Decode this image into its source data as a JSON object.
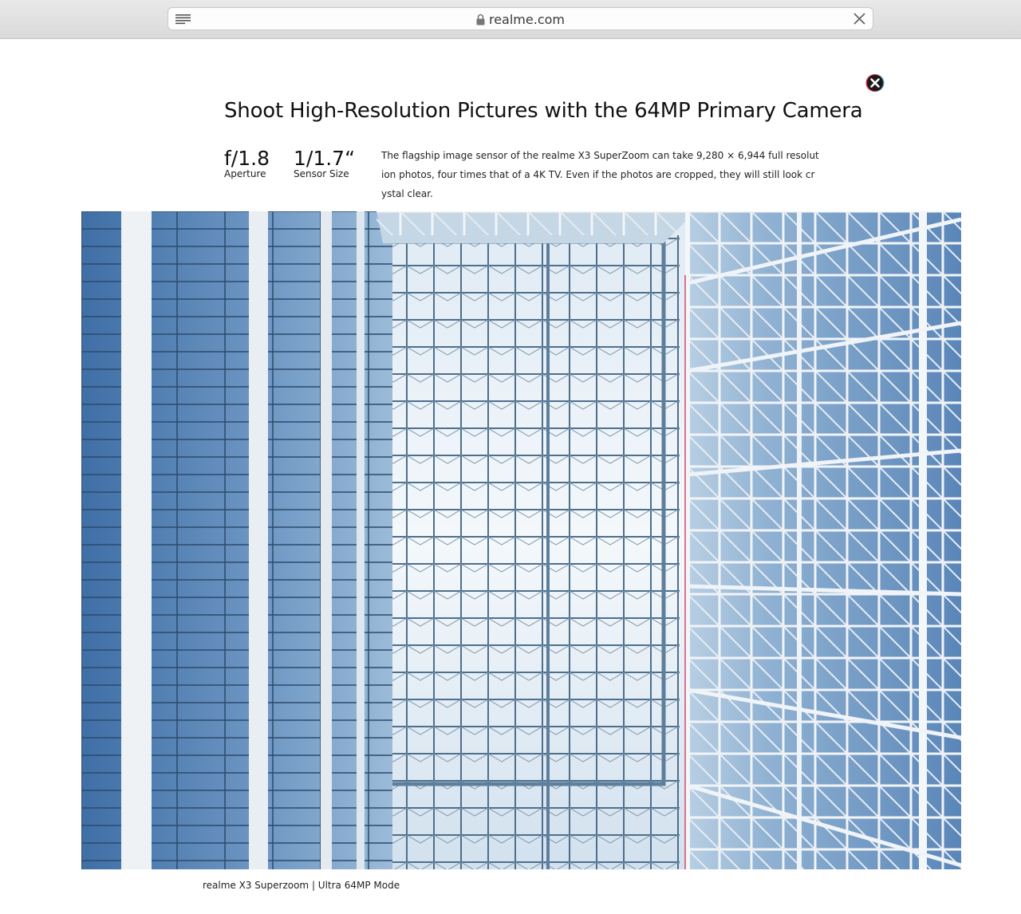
{
  "browser": {
    "url": "realme.com"
  },
  "page": {
    "title": "Shoot High-Resolution Pictures with the 64MP Primary Camera",
    "specs": [
      {
        "value": "f/1.8",
        "label": "Aperture"
      },
      {
        "value": "1/1.7“",
        "label": "Sensor Size"
      }
    ],
    "description": "The flagship image sensor of the realme X3 SuperZoom can take 9,280 × 6,944 full resolution photos, four times that of a 4K TV. Even if the photos are cropped, they will still look crystal clear.",
    "caption": "realme X3 Superzoom | Ultra 64MP Mode"
  },
  "icons": {
    "reader": "reader-view-icon",
    "lock": "lock-icon",
    "close": "close-icon",
    "badge": "extension-badge-icon"
  },
  "colors": {
    "sky": "#e8f1f8",
    "glass": "#5c86b4",
    "steel": "#ffffff"
  }
}
